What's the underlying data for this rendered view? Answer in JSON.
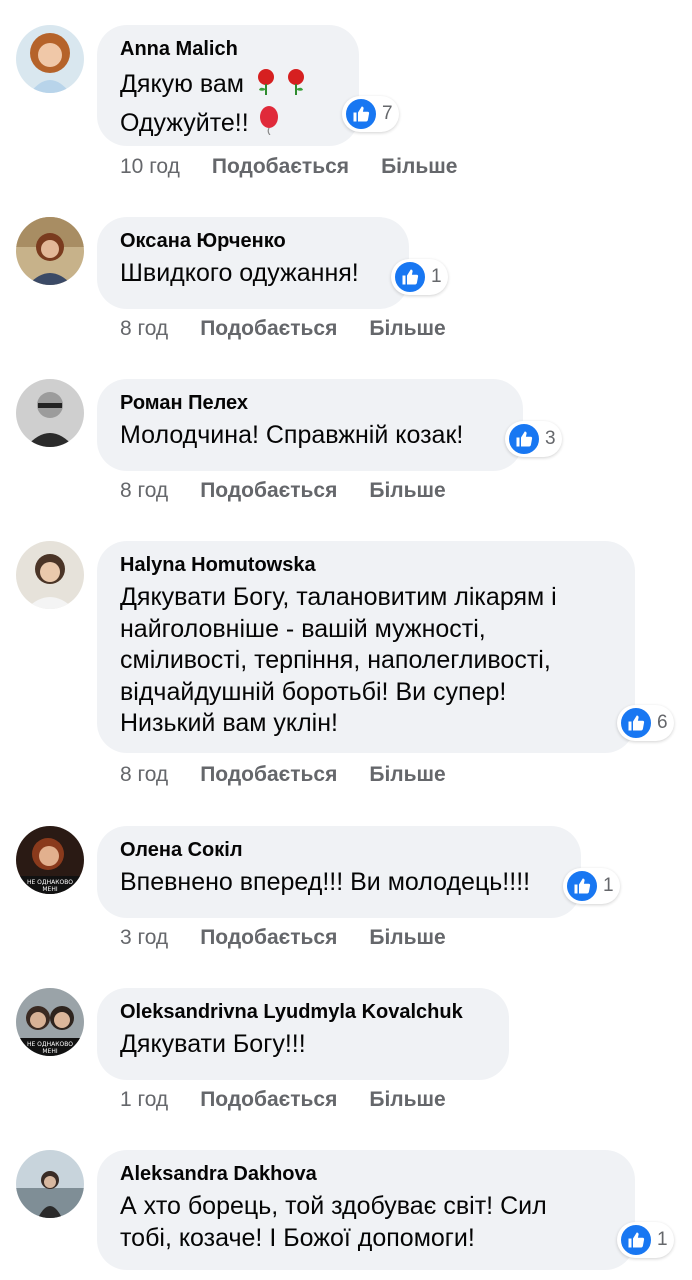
{
  "comments": [
    {
      "author": "Anna Malich",
      "text_line1": "Дякую вам",
      "text_line2": "Одужуйте!!",
      "reactions": "7",
      "time": "10 год",
      "like_label": "Подобається",
      "more_label": "Більше"
    },
    {
      "author": "Оксана Юрченко",
      "text": "Швидкого одужання!",
      "reactions": "1",
      "time": "8 год",
      "like_label": "Подобається",
      "more_label": "Більше"
    },
    {
      "author": "Роман Пелех",
      "text": "Молодчина! Справжній козак!",
      "reactions": "3",
      "time": "8 год",
      "like_label": "Подобається",
      "more_label": "Більше"
    },
    {
      "author": "Halyna Homutowska",
      "lines": [
        "Дякувати Богу, талановитим лікарям і",
        "найголовніше - вашій мужності,",
        "сміливості, терпіння, наполегливості,",
        "відчайдушній боротьбі! Ви супер!",
        "Низький вам уклін!"
      ],
      "reactions": "6",
      "time": "8 год",
      "like_label": "Подобається",
      "more_label": "Більше"
    },
    {
      "author": "Олена Сокіл",
      "text": "Впевнено вперед!!! Ви молодець!!!!",
      "reactions": "1",
      "time": "3 год",
      "like_label": "Подобається",
      "more_label": "Більше",
      "avatar_caption": "НЕ ОДНАКОВО МЕНІ"
    },
    {
      "author": "Oleksandrivna Lyudmyla Kovalchuk",
      "text": "Дякувати Богу!!!",
      "time": "1 год",
      "like_label": "Подобається",
      "more_label": "Більше",
      "avatar_caption": "НЕ ОДНАКОВО МЕНІ"
    },
    {
      "author": "Aleksandra Dakhova",
      "lines": [
        "А хто борець, той здобуває світ! Сил",
        "тобі, козаче! І Божої допомоги!"
      ],
      "reactions": "1"
    }
  ],
  "colors": {
    "bubble": "#f0f2f5",
    "like_blue": "#1877f2",
    "meta_gray": "#65676b",
    "text": "#050505"
  },
  "icons": {
    "like": "thumbs-up-icon",
    "rose": "rose-emoji-icon",
    "balloon": "balloon-emoji-icon"
  }
}
